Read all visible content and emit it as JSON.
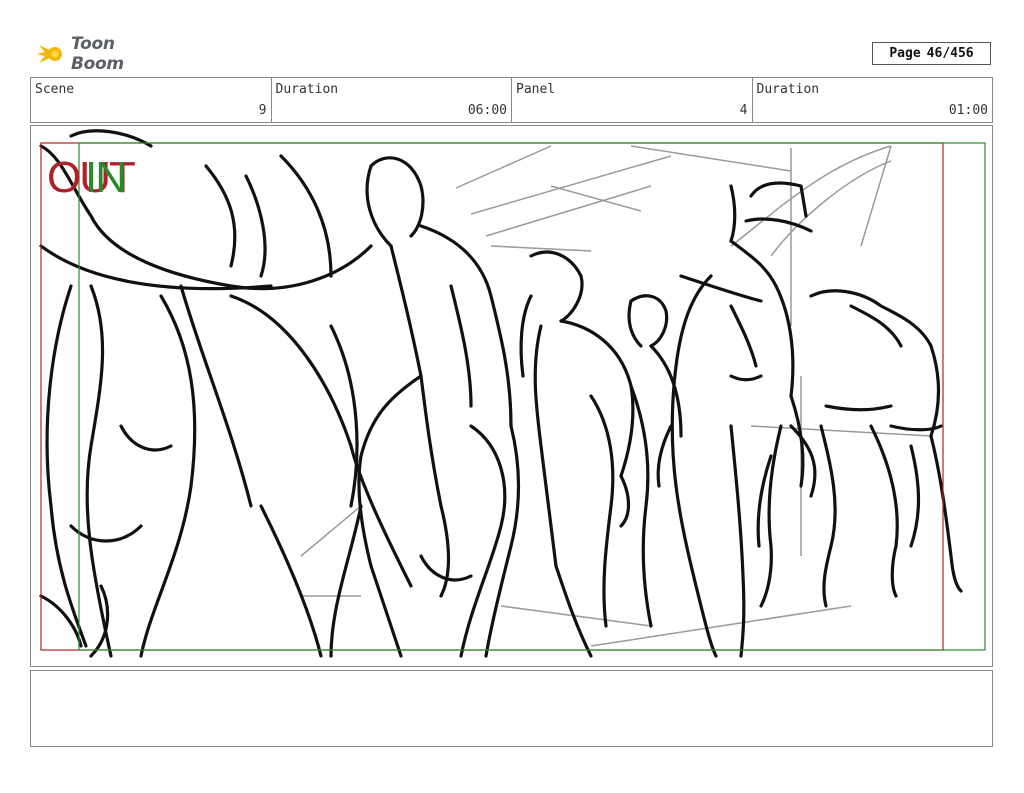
{
  "header": {
    "logo_text": "Toon Boom",
    "page_label": "Page",
    "page_value": "46/456"
  },
  "info": [
    {
      "label": "Scene",
      "value": "9"
    },
    {
      "label": "Duration",
      "value": "06:00"
    },
    {
      "label": "Panel",
      "value": "4"
    },
    {
      "label": "Duration",
      "value": "01:00"
    }
  ],
  "panel": {
    "out_label": "OUT",
    "in_label": "IN",
    "out_color": "#b0202a",
    "in_color": "#2a8a2a"
  },
  "notes": {}
}
